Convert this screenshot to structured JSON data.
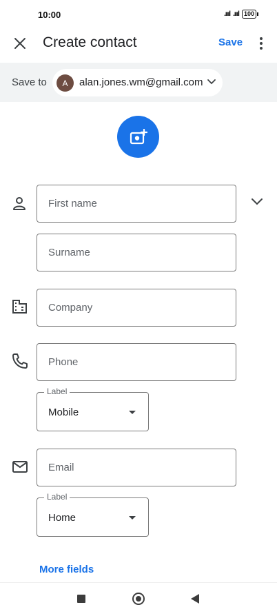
{
  "status_bar": {
    "time": "10:00",
    "signal1": ".ıııl",
    "signal2": ".ıııl",
    "battery": "100"
  },
  "app_bar": {
    "title": "Create contact",
    "save_label": "Save"
  },
  "save_to": {
    "label": "Save to",
    "avatar_letter": "A",
    "account": "alan.jones.wm@gmail.com"
  },
  "fields": {
    "first_name_placeholder": "First name",
    "surname_placeholder": "Surname",
    "company_placeholder": "Company",
    "phone_placeholder": "Phone",
    "phone_label_caption": "Label",
    "phone_label_value": "Mobile",
    "email_placeholder": "Email",
    "email_label_caption": "Label",
    "email_label_value": "Home"
  },
  "more_fields_label": "More fields",
  "colors": {
    "accent": "#1a73e8",
    "band": "#f1f3f4",
    "avatar": "#6d4c41"
  }
}
